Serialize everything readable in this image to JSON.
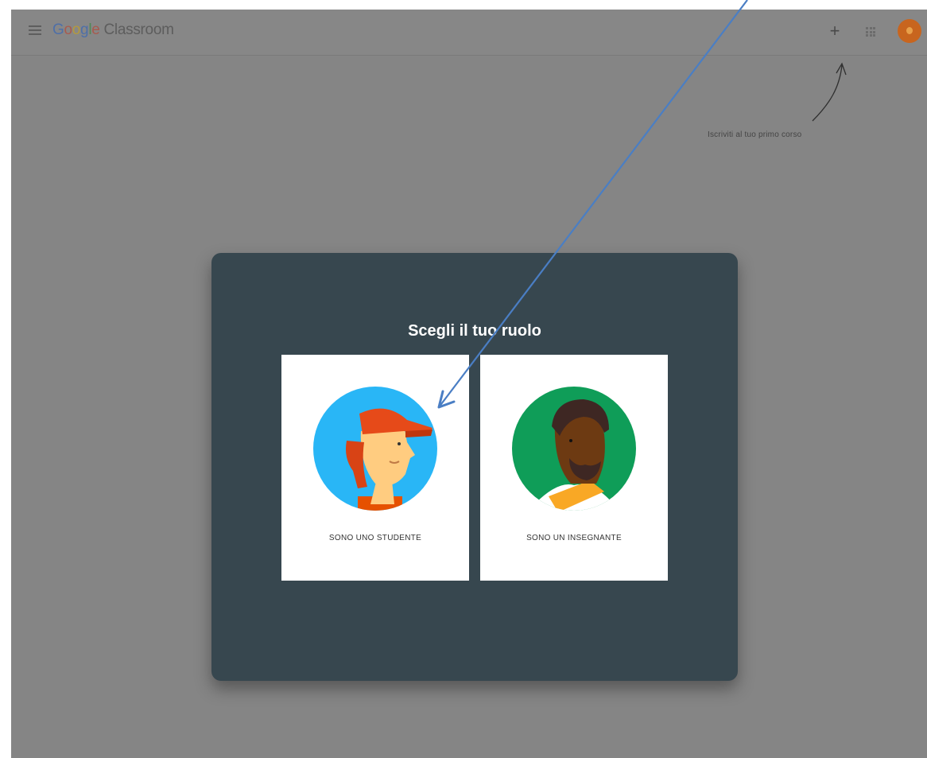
{
  "header": {
    "app_name_parts": [
      "G",
      "o",
      "o",
      "g",
      "l",
      "e"
    ],
    "app_name_rest": " Classroom",
    "plus_label": "+"
  },
  "hint": {
    "text": "Iscriviti al tuo primo corso"
  },
  "dialog": {
    "title": "Scegli il tuo ruolo",
    "roles": [
      {
        "label": "SONO UNO STUDENTE"
      },
      {
        "label": "SONO UN INSEGNANTE"
      }
    ]
  },
  "colors": {
    "dialog_bg": "#37474f",
    "student_circle": "#29b6f6",
    "teacher_circle": "#0f9d58",
    "annotation_arrow": "#4a7ec4"
  },
  "icons": [
    "menu-icon",
    "plus-icon",
    "apps-icon",
    "avatar"
  ]
}
